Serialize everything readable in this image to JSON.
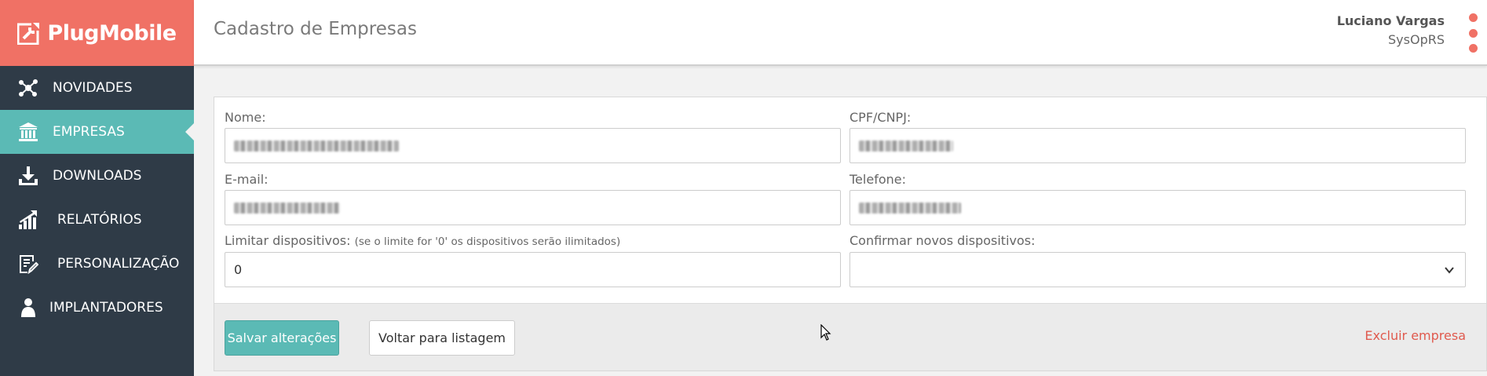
{
  "brand": {
    "name": "PlugMobile",
    "color": "#f07165"
  },
  "sidebar": {
    "items": [
      {
        "label": "NOVIDADES",
        "icon": "network-icon",
        "active": false
      },
      {
        "label": "EMPRESAS",
        "icon": "bank-icon",
        "active": true
      },
      {
        "label": "DOWNLOADS",
        "icon": "download-icon",
        "active": false
      },
      {
        "label": "RELATÓRIOS",
        "icon": "chart-bars-icon",
        "active": false
      },
      {
        "label": "PERSONALIZAÇÃO",
        "icon": "document-edit-icon",
        "active": false
      },
      {
        "label": "IMPLANTADORES",
        "icon": "person-icon",
        "active": false
      }
    ]
  },
  "header": {
    "title": "Cadastro de Empresas",
    "user_name": "Luciano Vargas",
    "user_org": "SysOpRS"
  },
  "form": {
    "nome_label": "Nome:",
    "cpf_label": "CPF/CNPJ:",
    "email_label": "E-mail:",
    "telefone_label": "Telefone:",
    "limitar_label": "Limitar dispositivos:",
    "limitar_hint": "(se o limite for '0' os dispositivos serão ilimitados)",
    "limitar_value": "0",
    "confirmar_label": "Confirmar novos dispositivos:",
    "confirmar_value": ""
  },
  "actions": {
    "save_label": "Salvar alterações",
    "back_label": "Voltar para listagem",
    "delete_label": "Excluir empresa"
  },
  "colors": {
    "accent": "#5bbab5",
    "sidebar_bg": "#2f3b47",
    "danger": "#e05a4e"
  }
}
